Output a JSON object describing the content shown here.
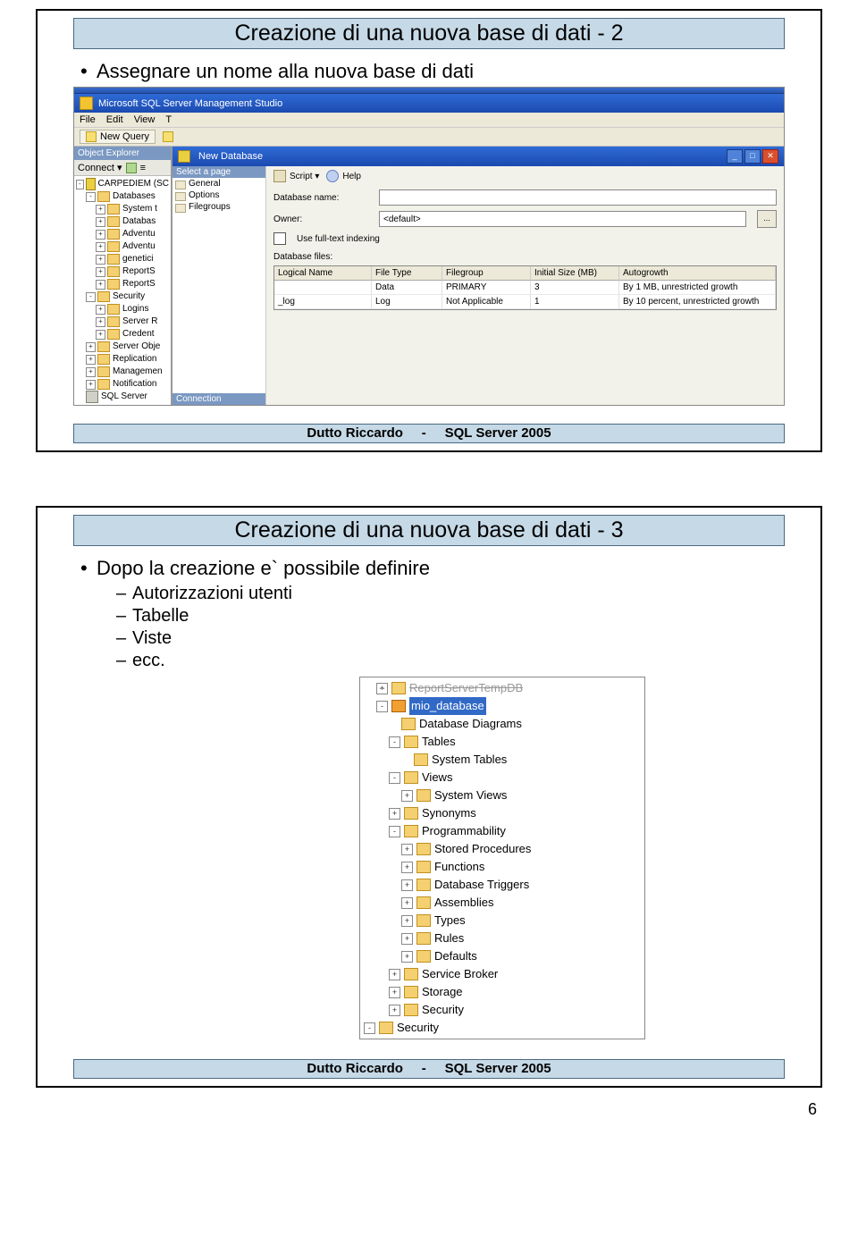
{
  "page_number": "6",
  "slide1": {
    "title": "Creazione di una nuova base di dati - 2",
    "bullet": "Assegnare un nome alla nuova base di dati",
    "footer": "Dutto Riccardo     -     SQL Server 2005",
    "ssms": {
      "app_title": "Microsoft SQL Server Management Studio",
      "menu": [
        "File",
        "Edit",
        "View",
        "T"
      ],
      "new_query": "New Query",
      "obj_explorer": "Object Explorer",
      "connect": "Connect ▾",
      "tree": {
        "server": "CARPEDIEM (SC",
        "databases": "Databases",
        "db_items": [
          "System t",
          "Databas",
          "Adventu",
          "Adventu",
          "genetici",
          "ReportS",
          "ReportS"
        ],
        "security": "Security",
        "sec_items": [
          "Logins",
          "Server R",
          "Credent"
        ],
        "rest": [
          "Server Obje",
          "Replication",
          "Managemen",
          "Notification"
        ],
        "sqlagent": "SQL Server"
      }
    },
    "dialog": {
      "title": "New Database",
      "select_page": "Select a page",
      "pages": [
        "General",
        "Options",
        "Filegroups"
      ],
      "connection": "Connection",
      "script": "Script ▾",
      "help": "Help",
      "db_name": "Database name:",
      "owner": "Owner:",
      "owner_val": "<default>",
      "fulltext": "Use full-text indexing",
      "files": "Database files:",
      "headers": [
        "Logical Name",
        "File Type",
        "Filegroup",
        "Initial Size (MB)",
        "Autogrowth"
      ],
      "rows": [
        [
          "",
          "Data",
          "PRIMARY",
          "3",
          "By 1 MB, unrestricted growth"
        ],
        [
          "_log",
          "Log",
          "Not Applicable",
          "1",
          "By 10 percent, unrestricted growth"
        ]
      ],
      "dots": "...",
      "min": "_",
      "max": "□",
      "close": "✕"
    }
  },
  "slide2": {
    "title": "Creazione di una nuova base di dati - 3",
    "bullet": "Dopo la creazione e` possibile definire",
    "sub": [
      "Autorizzazioni utenti",
      "Tabelle",
      "Viste",
      "ecc."
    ],
    "footer": "Dutto Riccardo     -     SQL Server 2005",
    "tree": {
      "top_cut": "ReportServerTempDB",
      "selected": "mio_database",
      "items": [
        {
          "ind": 2,
          "pm": "",
          "label": "Database Diagrams"
        },
        {
          "ind": 2,
          "pm": "-",
          "label": "Tables"
        },
        {
          "ind": 3,
          "pm": "",
          "label": "System Tables"
        },
        {
          "ind": 2,
          "pm": "-",
          "label": "Views"
        },
        {
          "ind": 3,
          "pm": "+",
          "label": "System Views"
        },
        {
          "ind": 2,
          "pm": "+",
          "label": "Synonyms"
        },
        {
          "ind": 2,
          "pm": "-",
          "label": "Programmability"
        },
        {
          "ind": 3,
          "pm": "+",
          "label": "Stored Procedures"
        },
        {
          "ind": 3,
          "pm": "+",
          "label": "Functions"
        },
        {
          "ind": 3,
          "pm": "+",
          "label": "Database Triggers"
        },
        {
          "ind": 3,
          "pm": "+",
          "label": "Assemblies"
        },
        {
          "ind": 3,
          "pm": "+",
          "label": "Types"
        },
        {
          "ind": 3,
          "pm": "+",
          "label": "Rules"
        },
        {
          "ind": 3,
          "pm": "+",
          "label": "Defaults"
        },
        {
          "ind": 2,
          "pm": "+",
          "label": "Service Broker"
        },
        {
          "ind": 2,
          "pm": "+",
          "label": "Storage"
        },
        {
          "ind": 2,
          "pm": "+",
          "label": "Security"
        }
      ],
      "bottom": "Security"
    }
  }
}
